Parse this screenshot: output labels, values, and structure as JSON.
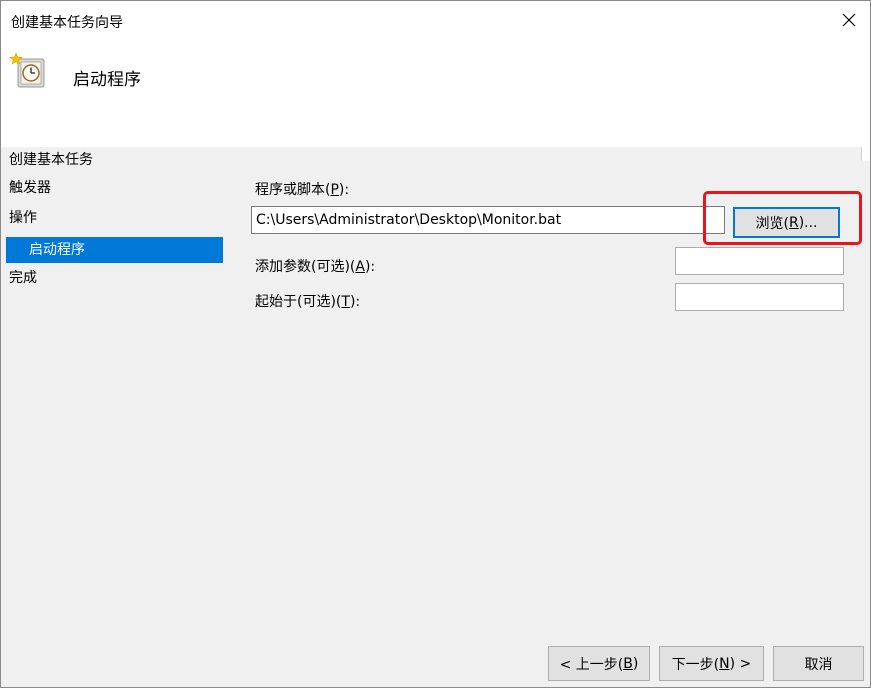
{
  "window": {
    "title": "创建基本任务向导",
    "close_glyph": "✕"
  },
  "header": {
    "title": "启动程序",
    "icon": "clock-task-icon"
  },
  "sidebar": {
    "items": [
      {
        "label": "创建基本任务",
        "selected": false
      },
      {
        "label": "触发器",
        "selected": false
      },
      {
        "label": "操作",
        "selected": false
      },
      {
        "label": "启动程序",
        "selected": true
      },
      {
        "label": "完成",
        "selected": false
      }
    ]
  },
  "form": {
    "program_label": "程序或脚本(",
    "program_label_key": "P",
    "program_label_end": "):",
    "program_value": "C:\\Users\\Administrator\\Desktop\\Monitor.bat",
    "browse_label": "浏览(",
    "browse_key": "R",
    "browse_end": ")...",
    "args_label": "添加参数(可选)(",
    "args_key": "A",
    "args_end": "):",
    "args_value": "",
    "start_in_label": "起始于(可选)(",
    "start_in_key": "T",
    "start_in_end": "):",
    "start_in_value": ""
  },
  "footer": {
    "back_label": "< 上一步(",
    "back_key": "B",
    "back_end": ")",
    "next_label": "下一步(",
    "next_key": "N",
    "next_end": ") >",
    "cancel_label": "取消"
  },
  "colors": {
    "selection": "#0078d7",
    "highlight": "#e8161c"
  }
}
